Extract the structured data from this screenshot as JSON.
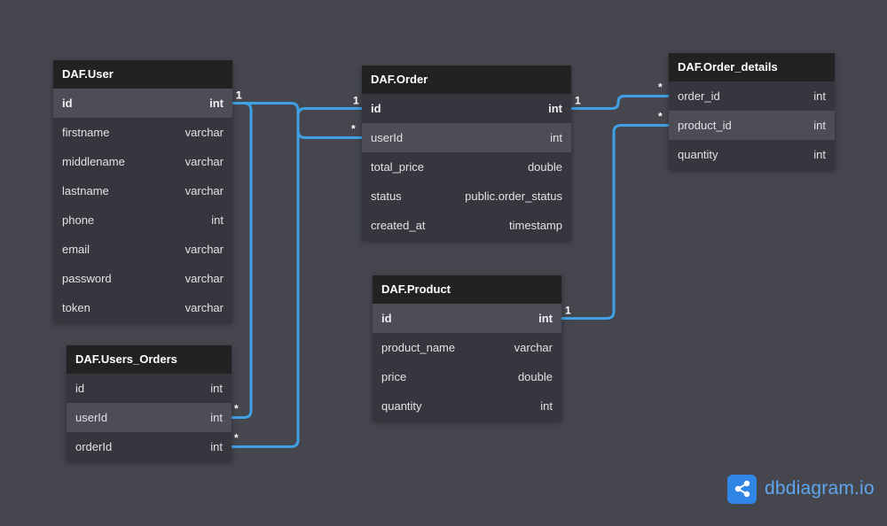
{
  "tables": [
    {
      "name": "DAF.User",
      "fields": [
        {
          "name": "id",
          "type": "int",
          "pk": true
        },
        {
          "name": "firstname",
          "type": "varchar"
        },
        {
          "name": "middlename",
          "type": "varchar"
        },
        {
          "name": "lastname",
          "type": "varchar"
        },
        {
          "name": "phone",
          "type": "int"
        },
        {
          "name": "email",
          "type": "varchar"
        },
        {
          "name": "password",
          "type": "varchar"
        },
        {
          "name": "token",
          "type": "varchar"
        }
      ]
    },
    {
      "name": "DAF.Users_Orders",
      "fields": [
        {
          "name": "id",
          "type": "int"
        },
        {
          "name": "userId",
          "type": "int"
        },
        {
          "name": "orderId",
          "type": "int"
        }
      ]
    },
    {
      "name": "DAF.Order",
      "fields": [
        {
          "name": "id",
          "type": "int",
          "pk": true
        },
        {
          "name": "userId",
          "type": "int"
        },
        {
          "name": "total_price",
          "type": "double"
        },
        {
          "name": "status",
          "type": "public.order_status"
        },
        {
          "name": "created_at",
          "type": "timestamp"
        }
      ]
    },
    {
      "name": "DAF.Product",
      "fields": [
        {
          "name": "id",
          "type": "int",
          "pk": true
        },
        {
          "name": "product_name",
          "type": "varchar"
        },
        {
          "name": "price",
          "type": "double"
        },
        {
          "name": "quantity",
          "type": "int"
        }
      ]
    },
    {
      "name": "DAF.Order_details",
      "fields": [
        {
          "name": "order_id",
          "type": "int"
        },
        {
          "name": "product_id",
          "type": "int"
        },
        {
          "name": "quantity",
          "type": "int"
        }
      ]
    }
  ],
  "relationships": [
    {
      "from": "DAF.User.id",
      "from_card": "1",
      "to": "DAF.Users_Orders.userId",
      "to_card": "*"
    },
    {
      "from": "DAF.User.id",
      "from_card": "1",
      "to": "DAF.Order.userId",
      "to_card": "*"
    },
    {
      "from": "DAF.Order.id",
      "from_card": "1",
      "to": "DAF.Users_Orders.orderId",
      "to_card": "*"
    },
    {
      "from": "DAF.Order.id",
      "from_card": "1",
      "to": "DAF.Order_details.order_id",
      "to_card": "*"
    },
    {
      "from": "DAF.Product.id",
      "from_card": "1",
      "to": "DAF.Order_details.product_id",
      "to_card": "*"
    }
  ],
  "colors": {
    "background": "#45464e",
    "header": "#222222",
    "row_dark": "#36363f",
    "row_light": "#4c4d56",
    "link": "#3fa0e3",
    "brand": "#2f86e6"
  },
  "brand": {
    "text": "dbdiagram.io",
    "icon": "share-nodes-icon"
  }
}
